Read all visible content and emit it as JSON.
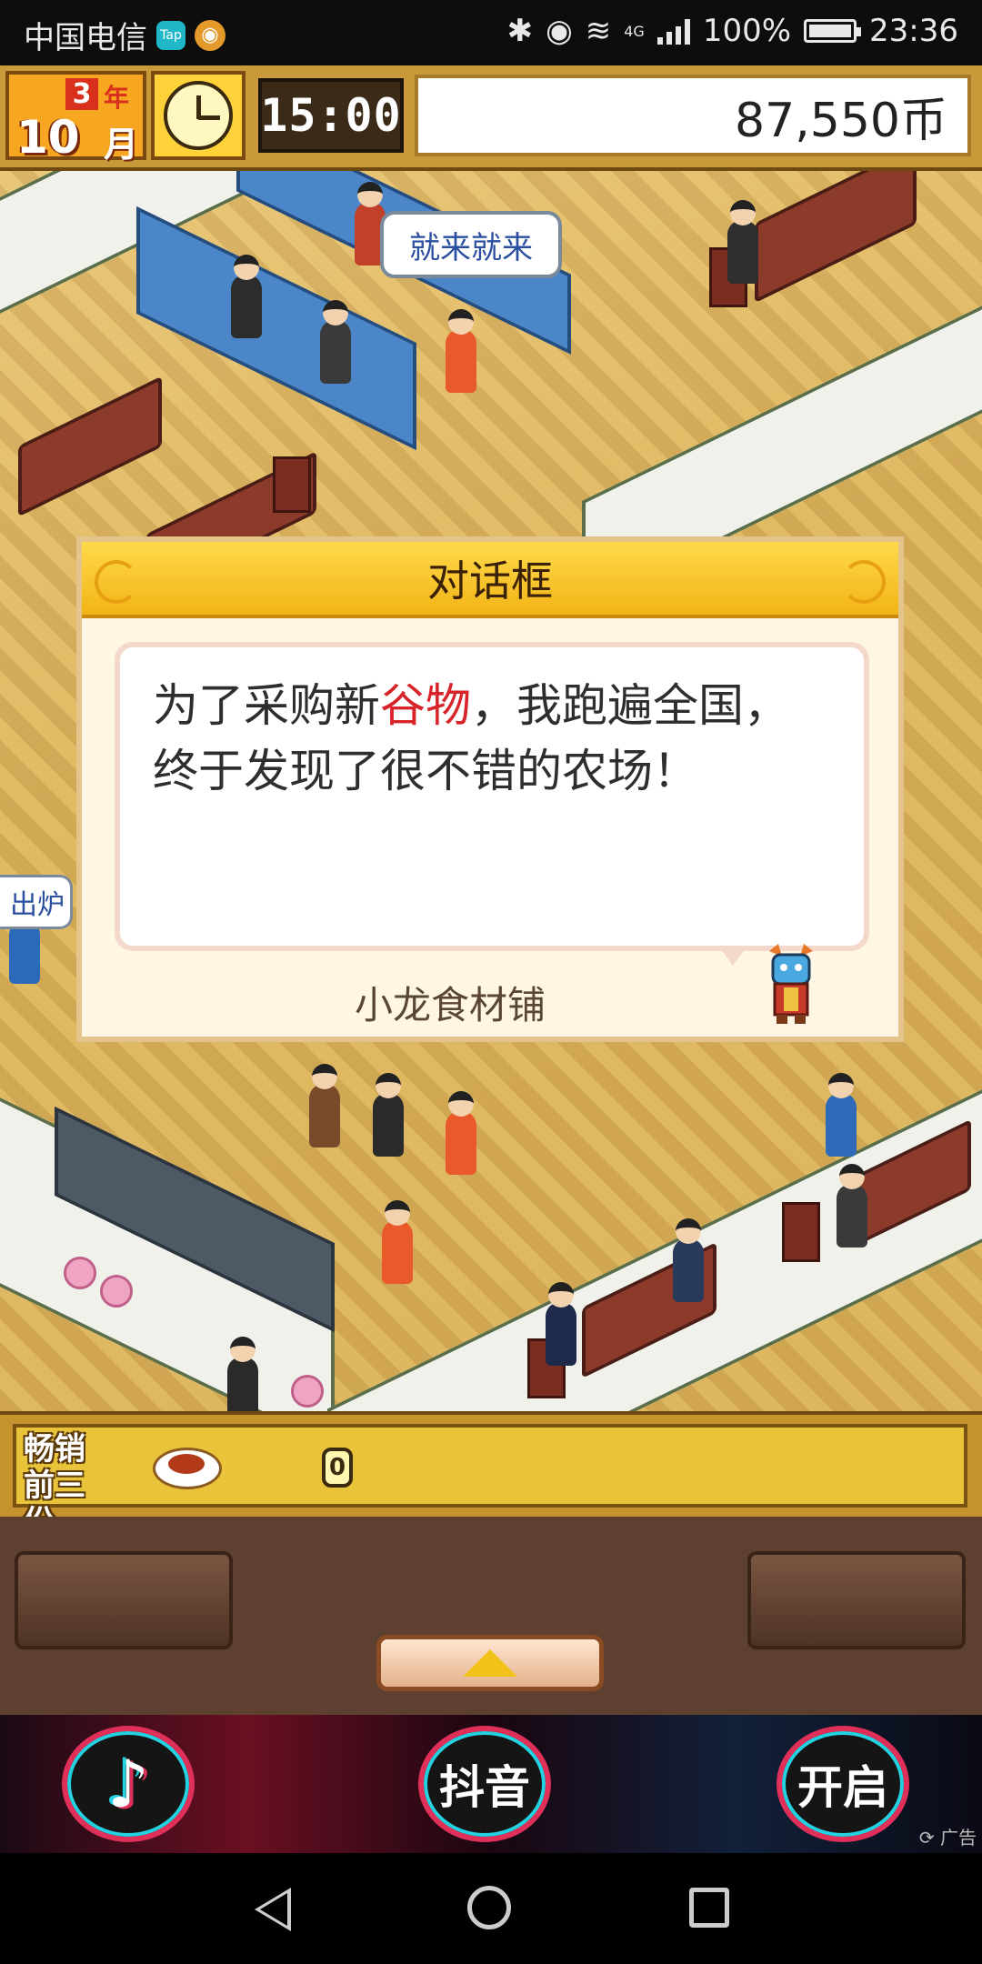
{
  "status_bar": {
    "carrier": "中国电信",
    "tap_label": "Tap",
    "network": "4G",
    "battery": "100%",
    "time": "23:36"
  },
  "hud": {
    "year": "3",
    "year_suffix": "年",
    "month": "10",
    "month_suffix": "月",
    "game_time": "15:00",
    "money": "87,550币"
  },
  "scene": {
    "speech_bubble": "就来就来",
    "side_tag": "出炉"
  },
  "dialog": {
    "title": "对话框",
    "text_before": "为了采购新",
    "text_highlight": "谷物",
    "text_after": "，我跑遍全国，终于发现了很不错的农场！",
    "speaker": "小龙食材铺",
    "highlight_color": "#d8232a"
  },
  "bestsellers": {
    "label_line1": "畅销",
    "label_line2": "前三份",
    "count": "0"
  },
  "ad": {
    "center_label": "抖音",
    "right_label": "开启",
    "ad_tag": "广告"
  },
  "icons": {
    "clock": "clock-icon",
    "dish": "dish-icon",
    "up_arrow": "up-arrow-icon",
    "tiktok": "tiktok-logo-icon",
    "dragon": "dragon-mascot-icon",
    "back": "back-icon",
    "home": "home-icon",
    "recent": "recent-apps-icon"
  }
}
